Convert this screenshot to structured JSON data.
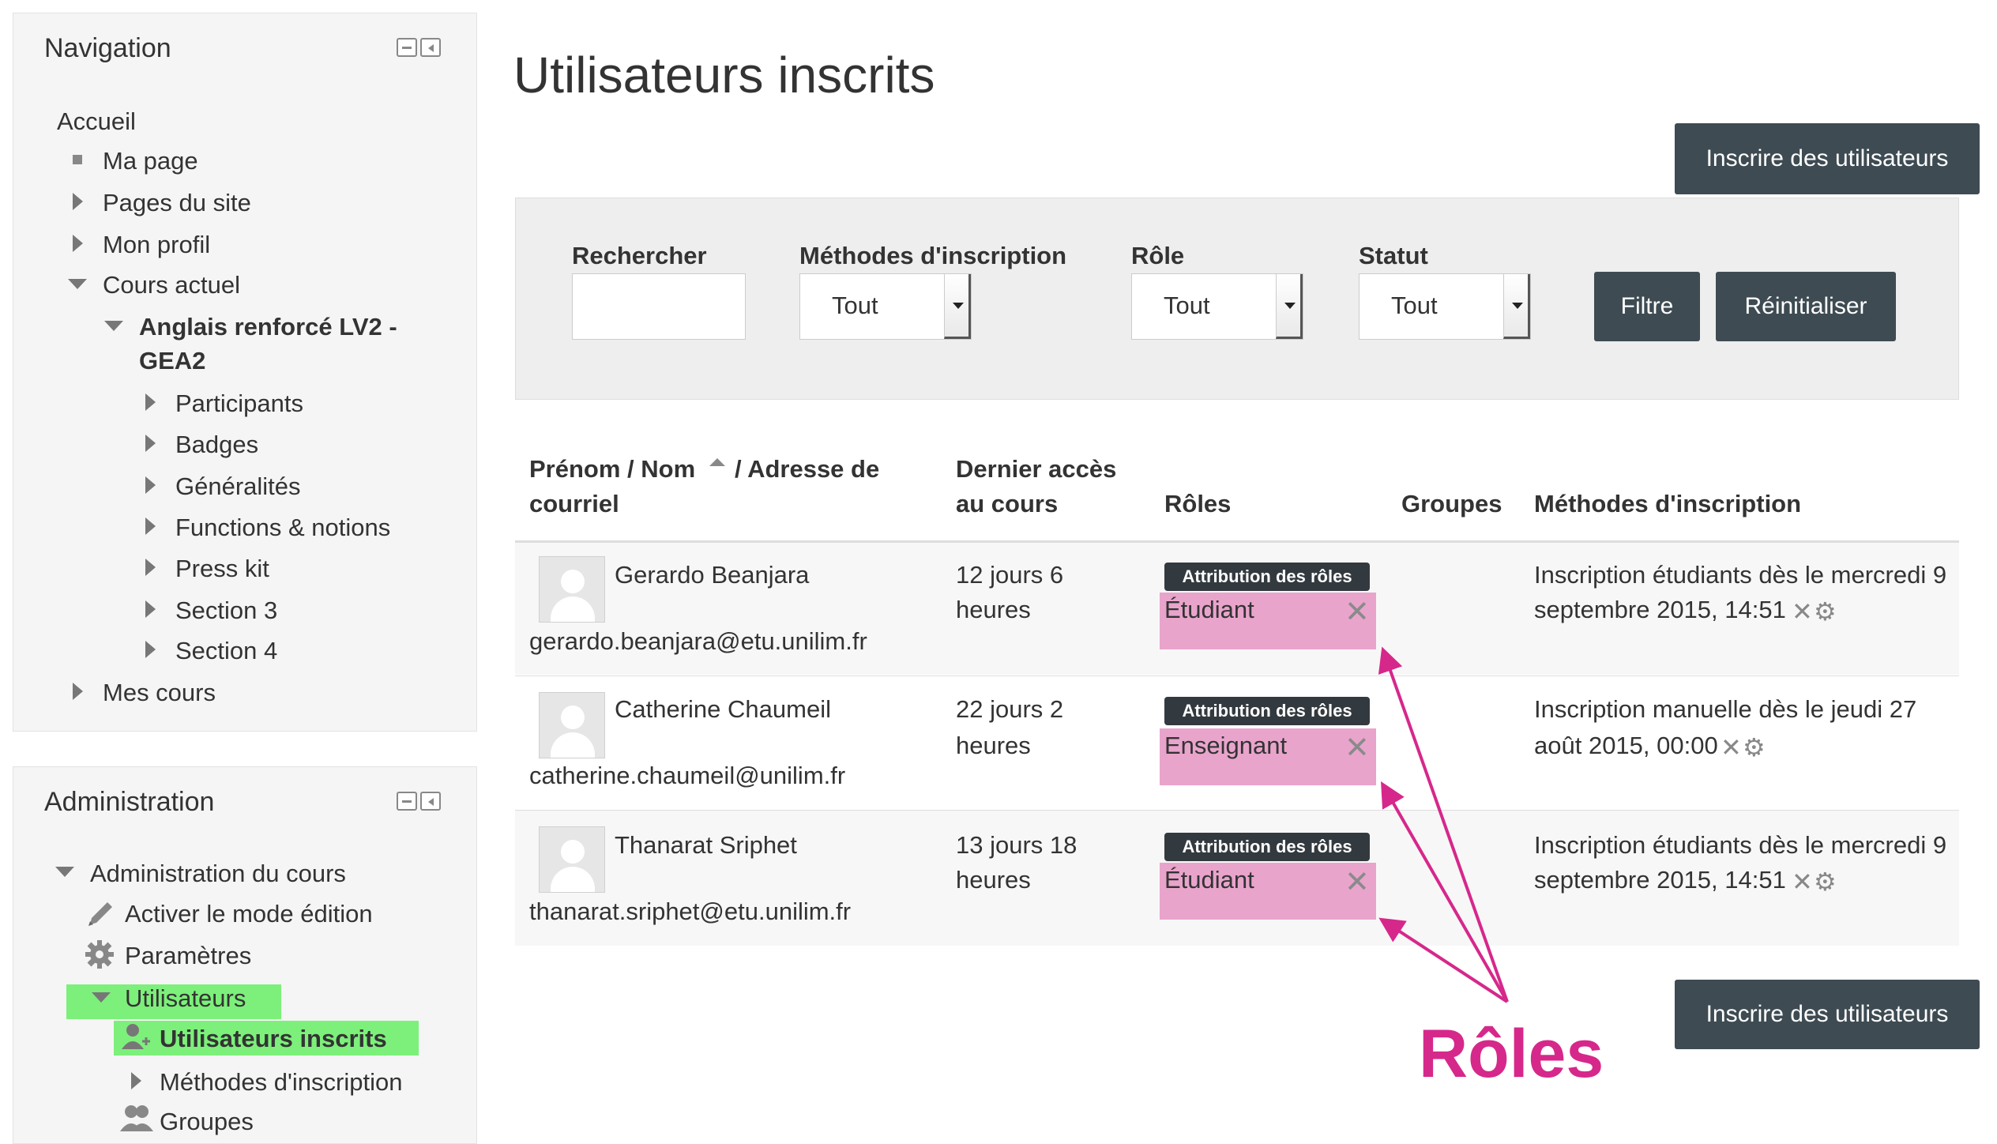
{
  "navigation": {
    "title": "Navigation",
    "items": [
      {
        "label": "Accueil"
      },
      {
        "label": "Ma page"
      },
      {
        "label": "Pages du site"
      },
      {
        "label": "Mon profil"
      },
      {
        "label": "Cours actuel"
      },
      {
        "label_line1": "Anglais renforcé LV2 -",
        "label_line2": "GEA2"
      },
      {
        "label": "Participants"
      },
      {
        "label": "Badges"
      },
      {
        "label": "Généralités"
      },
      {
        "label": "Functions & notions"
      },
      {
        "label": "Press kit"
      },
      {
        "label": "Section 3"
      },
      {
        "label": "Section 4"
      },
      {
        "label": "Mes cours"
      }
    ]
  },
  "administration": {
    "title": "Administration",
    "items": [
      {
        "label": "Administration du cours"
      },
      {
        "label": "Activer le mode édition"
      },
      {
        "label": "Paramètres"
      },
      {
        "label": "Utilisateurs"
      },
      {
        "label": "Utilisateurs inscrits"
      },
      {
        "label": "Méthodes d'inscription"
      },
      {
        "label": "Groupes"
      }
    ]
  },
  "main": {
    "title": "Utilisateurs inscrits",
    "enrol_button": "Inscrire des utilisateurs",
    "filters": {
      "search_label": "Rechercher",
      "search_value": "",
      "methods_label": "Méthodes d'inscription",
      "methods_value": "Tout",
      "role_label": "Rôle",
      "role_value": "Tout",
      "status_label": "Statut",
      "status_value": "Tout",
      "filter_button": "Filtre",
      "reset_button": "Réinitialiser"
    },
    "table": {
      "headers": {
        "name_line1_a": "Prénom / Nom",
        "name_line1_b": "/ Adresse de",
        "name_line2": "courriel",
        "access_line1": "Dernier accès",
        "access_line2": "au cours",
        "roles": "Rôles",
        "groups": "Groupes",
        "methods": "Méthodes d'inscription"
      },
      "rows": [
        {
          "name": "Gerardo Beanjara",
          "email": "gerardo.beanjara@etu.unilim.fr",
          "access_line1": "12 jours 6",
          "access_line2": "heures",
          "badge": "Attribution des rôles",
          "role": "Étudiant",
          "method_line1": "Inscription étudiants dès le mercredi 9",
          "method_line2": "septembre 2015, 14:51"
        },
        {
          "name": "Catherine Chaumeil",
          "email": "catherine.chaumeil@unilim.fr",
          "access_line1": "22 jours 2",
          "access_line2": "heures",
          "badge": "Attribution des rôles",
          "role": "Enseignant",
          "method_line1": "Inscription manuelle dès le jeudi 27",
          "method_line2": "août 2015, 00:00"
        },
        {
          "name": "Thanarat Sriphet",
          "email": "thanarat.sriphet@etu.unilim.fr",
          "access_line1": "13 jours 18",
          "access_line2": "heures",
          "badge": "Attribution des rôles",
          "role": "Étudiant",
          "method_line1": "Inscription étudiants dès le mercredi 9",
          "method_line2": "septembre 2015, 14:51"
        }
      ]
    }
  },
  "annotation": {
    "label": "Rôles",
    "color": "#d6288b",
    "highlight_green": "#7cf07a",
    "highlight_pink": "#e9a4cc"
  }
}
